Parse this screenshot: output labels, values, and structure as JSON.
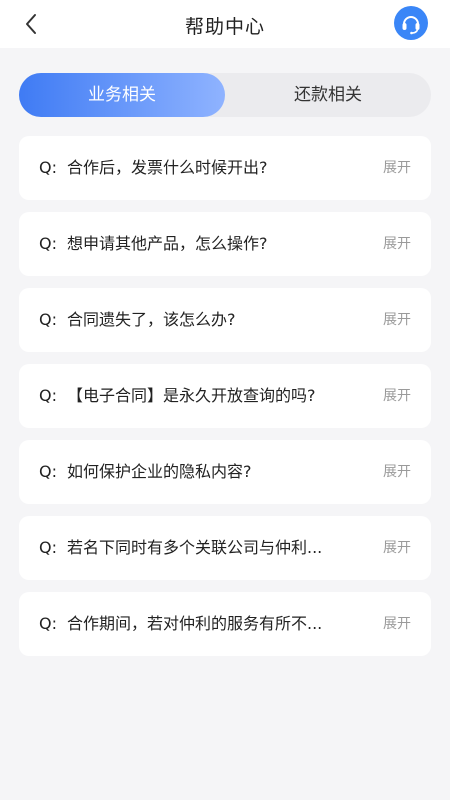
{
  "header": {
    "title": "帮助中心"
  },
  "tabs": [
    {
      "label": "业务相关",
      "active": true
    },
    {
      "label": "还款相关",
      "active": false
    }
  ],
  "faq": [
    {
      "prefix": "Q:",
      "question": "合作后，发票什么时候开出?",
      "action": "展开"
    },
    {
      "prefix": "Q:",
      "question": "想申请其他产品，怎么操作?",
      "action": "展开"
    },
    {
      "prefix": "Q:",
      "question": "合同遗失了，该怎么办?",
      "action": "展开"
    },
    {
      "prefix": "Q:",
      "question": "【电子合同】是永久开放查询的吗?",
      "action": "展开"
    },
    {
      "prefix": "Q:",
      "question": "如何保护企业的隐私内容?",
      "action": "展开"
    },
    {
      "prefix": "Q:",
      "question": "若名下同时有多个关联公司与仲利...",
      "action": "展开"
    },
    {
      "prefix": "Q:",
      "question": "合作期间，若对仲利的服务有所不...",
      "action": "展开"
    }
  ],
  "colors": {
    "accent": "#3f7bf4",
    "background": "#f5f5f7"
  }
}
